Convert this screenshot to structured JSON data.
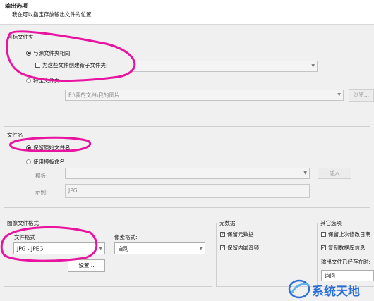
{
  "header": {
    "title": "输出选项",
    "subtitle": "我在可以指定存放输出文件的位置"
  },
  "destination": {
    "group_label": "目标文件夹",
    "same_as_source_label": "与源文件夹相同",
    "create_subfolder_label": "为这些文件创建新子文件夹:",
    "specific_folder_label": "特定文件夹:",
    "folder_path": "E:\\我的文档\\我的图片",
    "browse_label": "浏览..."
  },
  "filename": {
    "group_label": "文件名",
    "keep_original_label": "保留原始文件名",
    "use_template_label": "使用模板命名",
    "template_label": "模板:",
    "insert_label": "插入",
    "example_label": "示例:",
    "example_value": "JPG"
  },
  "image_format": {
    "group_label": "图像文件格式",
    "file_format_label": "文件格式",
    "file_format_value": "JPG - JPEG",
    "pixel_format_label": "像素格式:",
    "pixel_format_value": "自动",
    "settings_label": "设置..."
  },
  "metadata": {
    "group_label": "元数据",
    "keep_metadata_label": "保留元数据",
    "keep_embedded_label": "保留内嵌音频"
  },
  "other": {
    "group_label": "其它选项",
    "keep_modified_label": "保留上次修改日期",
    "copy_db_label": "复制数据库信息",
    "exists_label": "输出文件已经存在时:",
    "exists_value": "询问"
  },
  "watermark": {
    "text": "系统天地"
  },
  "colors": {
    "highlight": "#e8139f",
    "watermark_blue": "#2a6fd6"
  }
}
